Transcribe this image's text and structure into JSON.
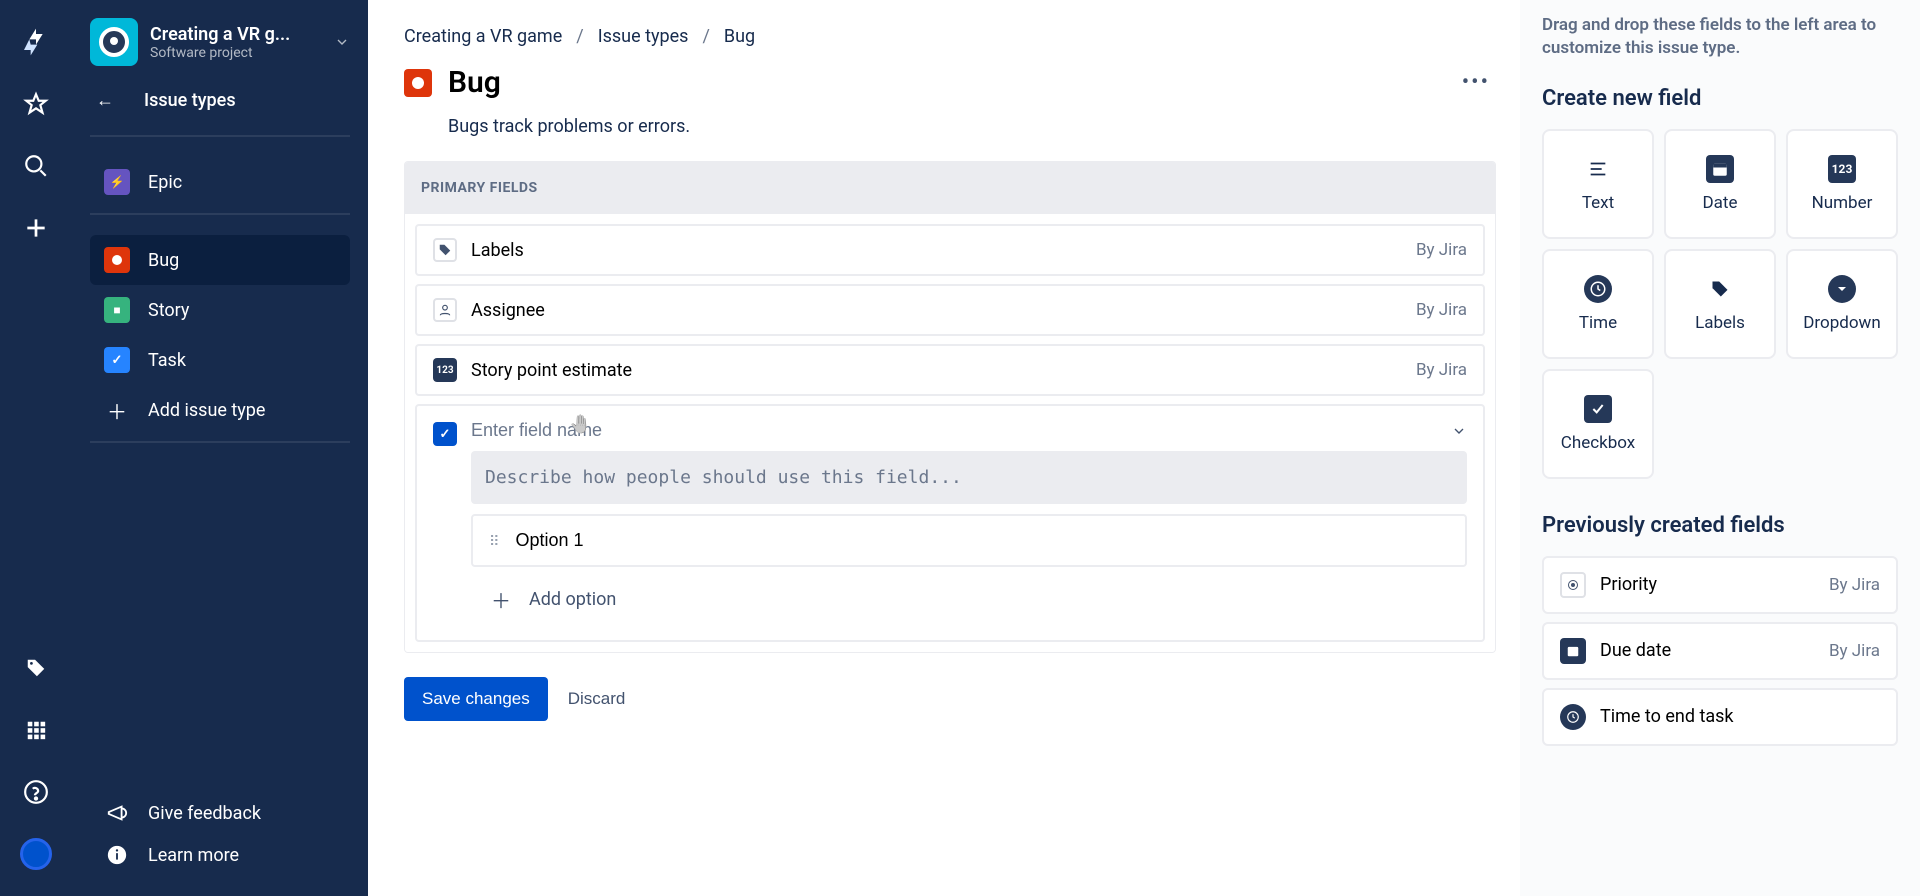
{
  "project": {
    "name": "Creating a VR g...",
    "subtitle": "Software project"
  },
  "sidebar": {
    "back_label": "Issue types",
    "groups": {
      "top": [
        {
          "label": "Epic",
          "kind": "epic"
        }
      ],
      "types": [
        {
          "label": "Bug",
          "kind": "bug",
          "active": true
        },
        {
          "label": "Story",
          "kind": "story"
        },
        {
          "label": "Task",
          "kind": "task"
        }
      ],
      "add_label": "Add issue type"
    },
    "footer": {
      "feedback": "Give feedback",
      "learn": "Learn more"
    }
  },
  "breadcrumbs": [
    "Creating a VR game",
    "Issue types",
    "Bug"
  ],
  "issue": {
    "title": "Bug",
    "description": "Bugs track problems or errors."
  },
  "primary_fields_header": "PRIMARY FIELDS",
  "fields": [
    {
      "name": "Labels",
      "source": "By Jira",
      "icon": "tag"
    },
    {
      "name": "Assignee",
      "source": "By Jira",
      "icon": "person"
    },
    {
      "name": "Story point estimate",
      "source": "By Jira",
      "icon": "number"
    }
  ],
  "new_field": {
    "name_placeholder": "Enter field name",
    "desc_placeholder": "Describe how people should use this field...",
    "option_value": "Option 1",
    "add_option_label": "Add option"
  },
  "actions": {
    "save": "Save changes",
    "discard": "Discard"
  },
  "right": {
    "help": "Drag and drop these fields to the left area to customize this issue type.",
    "create_header": "Create new field",
    "tiles": [
      {
        "label": "Text",
        "icon": "text"
      },
      {
        "label": "Date",
        "icon": "date"
      },
      {
        "label": "Number",
        "icon": "number"
      },
      {
        "label": "Time",
        "icon": "time"
      },
      {
        "label": "Labels",
        "icon": "tag"
      },
      {
        "label": "Dropdown",
        "icon": "dropdown"
      },
      {
        "label": "Checkbox",
        "icon": "checkbox"
      }
    ],
    "prev_header": "Previously created fields",
    "prev_fields": [
      {
        "name": "Priority",
        "source": "By Jira",
        "icon": "radio"
      },
      {
        "name": "Due date",
        "source": "By Jira",
        "icon": "date"
      },
      {
        "name": "Time to end task",
        "source": "",
        "icon": "time"
      }
    ]
  }
}
